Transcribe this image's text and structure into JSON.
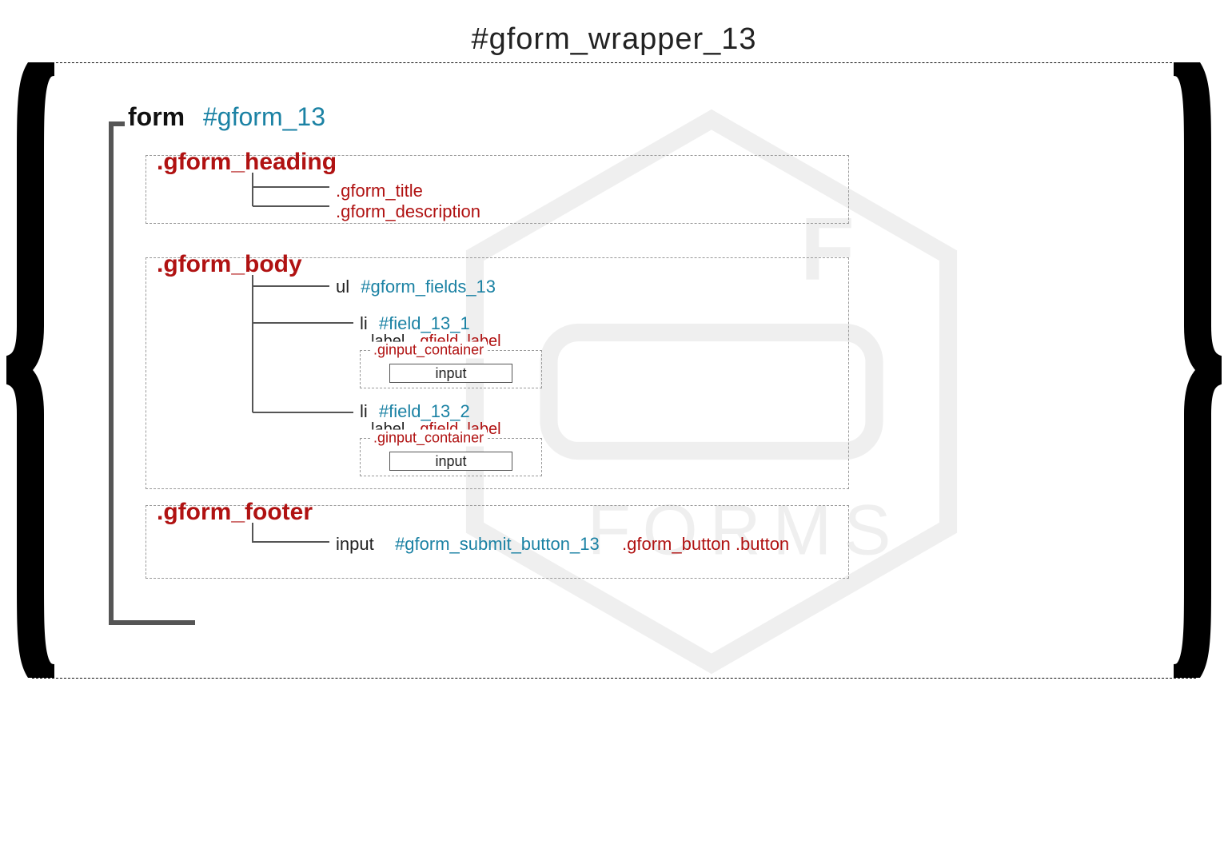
{
  "title": "#gform_wrapper_13",
  "form": {
    "tag": "form",
    "id": "#gform_13"
  },
  "sections": {
    "heading": {
      "class": ".gform_heading",
      "children": {
        "title": ".gform_title",
        "description": ".gform_description"
      }
    },
    "body": {
      "class": ".gform_body",
      "ul": {
        "tag": "ul",
        "id": "#gform_fields_13"
      },
      "fields": [
        {
          "tag": "li",
          "id": "#field_13_1",
          "label_tag": "label",
          "label_class": ".gfield_label",
          "container_class": ".ginput_container",
          "input_tag": "input"
        },
        {
          "tag": "li",
          "id": "#field_13_2",
          "label_tag": "label",
          "label_class": ".gfield_label",
          "container_class": ".ginput_container",
          "input_tag": "input"
        }
      ]
    },
    "footer": {
      "class": ".gform_footer",
      "input": {
        "tag": "input",
        "id": "#gform_submit_button_13",
        "classes": ".gform_button .button"
      }
    }
  }
}
